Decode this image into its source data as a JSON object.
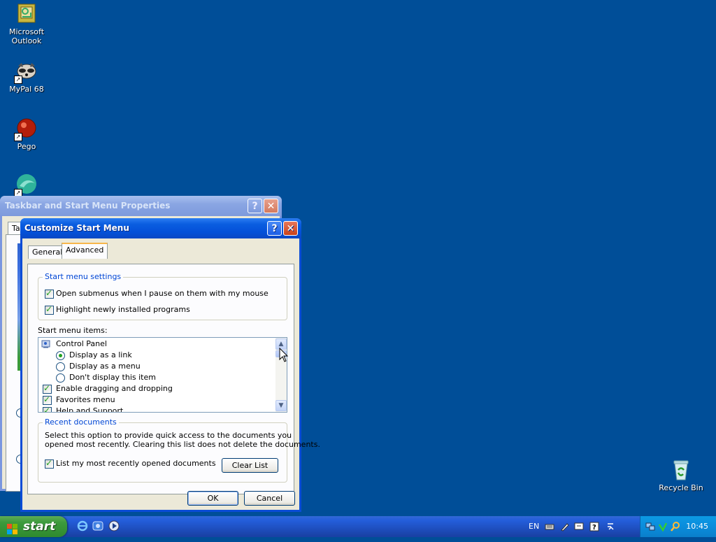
{
  "desktop": {
    "icons": [
      {
        "label": "Microsoft Outlook"
      },
      {
        "label": "MyPal 68"
      },
      {
        "label": "Pego"
      },
      {
        "label": ""
      },
      {
        "label": "Recycle Bin"
      }
    ]
  },
  "back_window": {
    "title": "Taskbar and Start Menu Properties",
    "tab_partial": "Ta",
    "help_glyph": "?",
    "close_glyph": "✕"
  },
  "dialog": {
    "title": "Customize Start Menu",
    "help_glyph": "?",
    "close_glyph": "✕",
    "tabs": [
      {
        "label": "General",
        "active": false
      },
      {
        "label": "Advanced",
        "active": true
      }
    ],
    "start_menu_settings": {
      "legend": "Start menu settings",
      "options": [
        {
          "label": "Open submenus when I pause on them with my mouse",
          "checked": true
        },
        {
          "label": "Highlight newly installed programs",
          "checked": true
        }
      ]
    },
    "items_label": "Start menu items:",
    "items": [
      {
        "kind": "header",
        "label": "Control Panel"
      },
      {
        "kind": "radio",
        "label": "Display as a link",
        "checked": true
      },
      {
        "kind": "radio",
        "label": "Display as a menu",
        "checked": false
      },
      {
        "kind": "radio",
        "label": "Don't display this item",
        "checked": false
      },
      {
        "kind": "check",
        "label": "Enable dragging and dropping",
        "checked": true
      },
      {
        "kind": "check",
        "label": "Favorites menu",
        "checked": true
      },
      {
        "kind": "check",
        "label": "Help and Support",
        "checked": true
      }
    ],
    "recent": {
      "legend": "Recent documents",
      "description_line1": "Select this option to provide quick access to the documents you",
      "description_line2": "opened most recently.  Clearing this list does not delete the documents.",
      "checkbox_label": "List my most recently opened documents",
      "checked": true,
      "clear_button": "Clear List"
    },
    "ok_button": "OK",
    "cancel_button": "Cancel"
  },
  "taskbar": {
    "start_label": "start",
    "language": "EN",
    "clock": "10:45"
  },
  "colors": {
    "desktop": "#004e98",
    "dialog_face": "#ece9d8",
    "legend_text": "#0046d5",
    "check_mark": "#21a121"
  }
}
